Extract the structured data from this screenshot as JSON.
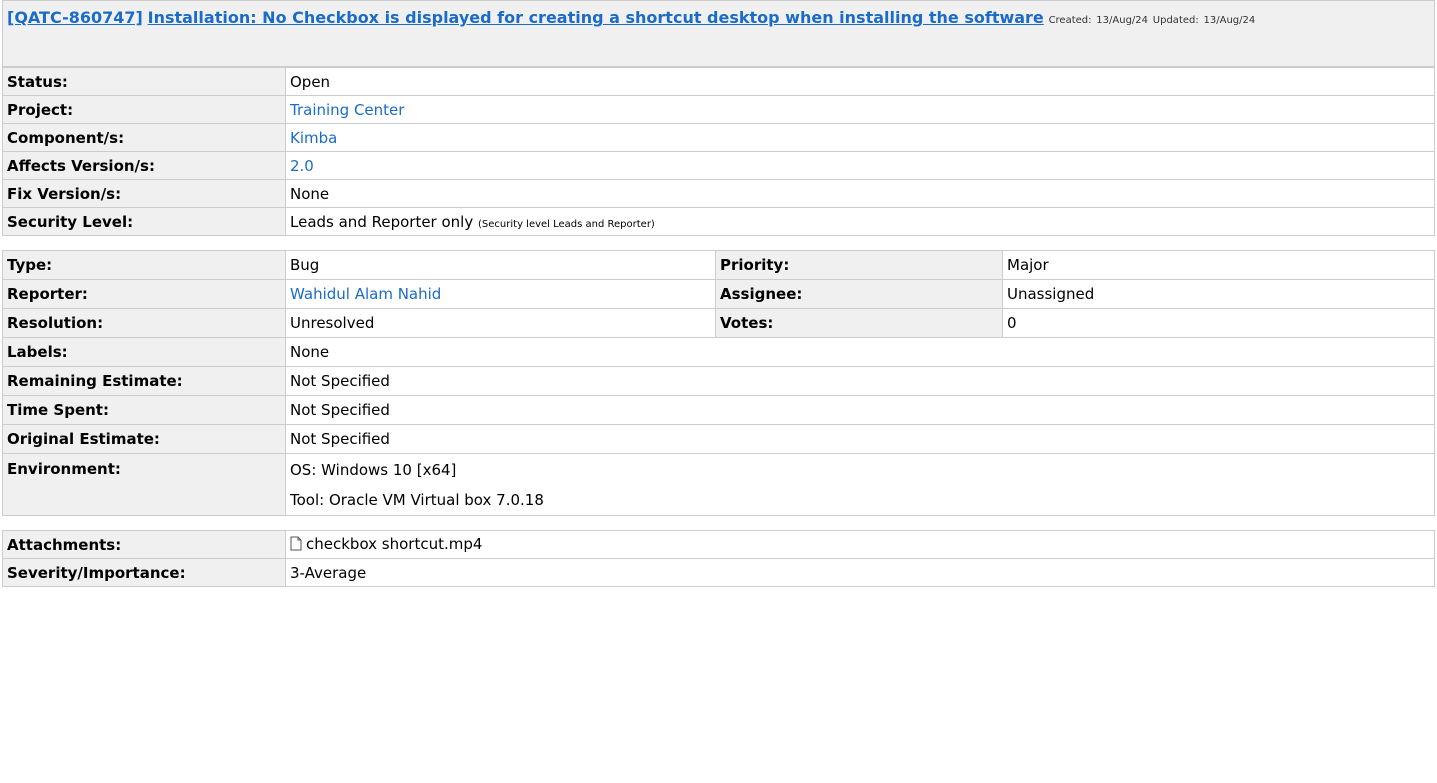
{
  "header": {
    "key": "[QATC-860747]",
    "summary": "Installation: No Checkbox is displayed for creating a shortcut desktop when installing the software",
    "created_label": "Created:",
    "created": "13/Aug/24",
    "updated_label": "Updated:",
    "updated": "13/Aug/24"
  },
  "details": {
    "status_label": "Status:",
    "status": "Open",
    "project_label": "Project:",
    "project": "Training Center",
    "component_label": "Component/s:",
    "component": "Kimba",
    "affects_label": "Affects Version/s:",
    "affects": "2.0",
    "fix_label": "Fix Version/s:",
    "fix": "None",
    "security_label": "Security Level:",
    "security": "Leads and Reporter only",
    "security_note": "(Security level Leads and Reporter)"
  },
  "people": {
    "type_label": "Type:",
    "type": "Bug",
    "priority_label": "Priority:",
    "priority": "Major",
    "reporter_label": "Reporter:",
    "reporter": "Wahidul Alam Nahid",
    "assignee_label": "Assignee:",
    "assignee": "Unassigned",
    "resolution_label": "Resolution:",
    "resolution": "Unresolved",
    "votes_label": "Votes:",
    "votes": "0",
    "labels_label": "Labels:",
    "labels": "None",
    "remaining_label": "Remaining Estimate:",
    "remaining": "Not Specified",
    "timespent_label": "Time Spent:",
    "timespent": "Not Specified",
    "original_label": "Original Estimate:",
    "original": "Not Specified",
    "environment_label": "Environment:",
    "environment_line1": "OS: Windows 10 [x64]",
    "environment_line2": "Tool: Oracle VM Virtual  box 7.0.18"
  },
  "extra": {
    "attachments_label": "Attachments:",
    "attachment_icon": "file-icon",
    "attachment_file": "checkbox shortcut.mp4",
    "severity_label": "Severity/Importance:",
    "severity": "3-Average"
  }
}
